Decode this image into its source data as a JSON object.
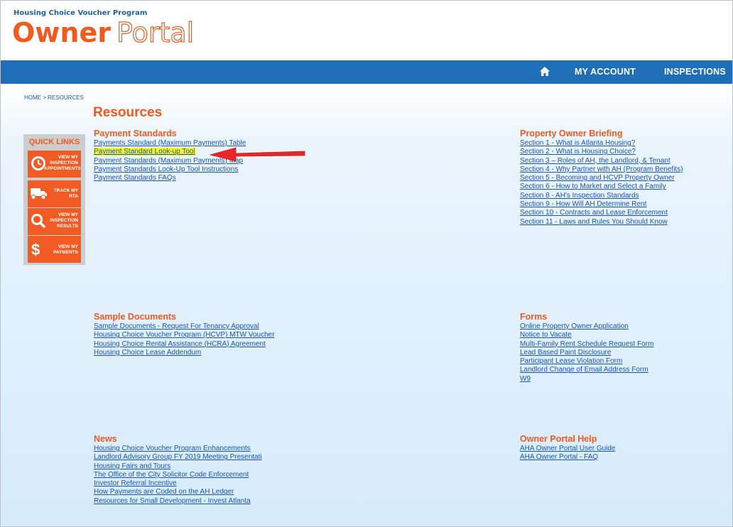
{
  "header": {
    "program": "Housing Choice Voucher Program",
    "logo_owner": "Owner",
    "logo_portal": "Portal"
  },
  "nav": {
    "home_icon": "home-icon",
    "my_account": "MY ACCOUNT",
    "inspections": "INSPECTIONS"
  },
  "breadcrumb": {
    "home": "HOME",
    "sep": " > ",
    "current": "RESOURCES"
  },
  "page_title": "Resources",
  "quick_links": {
    "title": "QUICK LINKS",
    "items": [
      {
        "icon": "clock-icon",
        "label": "VIEW MY INSPECTION APPOINTMENTS"
      },
      {
        "icon": "truck-icon",
        "label": "TRACK MY RTA"
      },
      {
        "icon": "search-icon",
        "label": "VIEW MY INSPECTION RESULTS"
      },
      {
        "icon": "dollar-icon",
        "label": "VIEW MY PAYMENTS"
      }
    ]
  },
  "payment_standards": {
    "title": "Payment Standards",
    "links": [
      "Payments Standard (Maximum Payments) Table",
      "Payment Standard Look-up Tool",
      "Payment Standards (Maximum Payments) Map",
      "Payment Standards Look-Up Tool Instructions",
      "Payment Standards FAQs"
    ]
  },
  "owner_briefing": {
    "title": "Property Owner Briefing",
    "links": [
      "Section 1 - What is Atlanta Housing?",
      "Section 2 - What is Housing Choice?",
      "Section 3 – Roles of AH, the Landlord, & Tenant",
      "Section 4 - Why Partner with AH (Program Benefits)",
      "Section 5 - Becoming and HCVP Property Owner",
      "Section 6 - How to Market and Select a Family",
      "Section 8 - AH's Inspection Standards",
      "Section 9 - How Will AH Determine Rent",
      "Section 10 - Contracts and Lease Enforcement",
      "Section 11 - Laws and Rules You Should Know"
    ]
  },
  "sample_documents": {
    "title": "Sample Documents",
    "links": [
      "Sample Documents - Request For Tenancy Approval",
      "Housing Choice Voucher Program (HCVP) MTW Voucher",
      "Housing Choice Rental Assistance (HCRA) Agreement",
      "Housing Choice Lease Addendum"
    ]
  },
  "forms": {
    "title": "Forms",
    "links": [
      "Online Property Owner Application",
      "Notice to Vacate",
      "Multi-Family Rent Schedule Request Form",
      "Lead Based Paint Disclosure",
      "Participant Lease Violation Form",
      "Landlord Change of Email Address Form",
      "W9"
    ]
  },
  "news": {
    "title": "News",
    "links": [
      "Housing Choice Voucher Program Enhancements",
      "Landlord Advisory Group FY 2019 Meeting Presentati",
      "Housing Fairs and Tours",
      "The Office of the City Solicitor Code Enforcement",
      "Investor Referral Incentive",
      "How Payments are Coded on the AH Ledger",
      "Resources for Small Development - Invest Atlanta"
    ]
  },
  "owner_portal_help": {
    "title": "Owner Portal Help",
    "links": [
      "AHA Owner Portal User Guide",
      "AHA Owner Portal - FAQ"
    ]
  },
  "colors": {
    "brand_orange": "#f05a1d",
    "nav_blue": "#1f6eb8",
    "link_blue": "#1a55b5",
    "highlight": "#f5f52a",
    "arrow_red": "#e8262a"
  }
}
